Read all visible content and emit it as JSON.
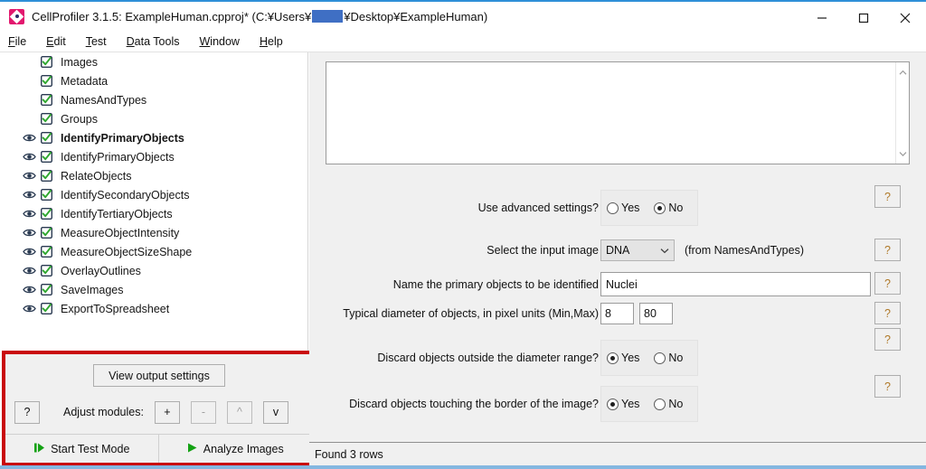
{
  "window": {
    "title_prefix": "CellProfiler 3.1.5: ExampleHuman.cpproj* (C:¥Users¥",
    "title_suffix": "¥Desktop¥ExampleHuman)",
    "app_icon": "cellprofiler-logo-icon",
    "controls": {
      "minimize": "minimize-icon",
      "maximize": "maximize-icon",
      "close": "close-icon"
    },
    "accent_color": "#2f8fd8"
  },
  "menubar": {
    "items": [
      {
        "accel": "F",
        "rest": "ile"
      },
      {
        "accel": "E",
        "rest": "dit"
      },
      {
        "accel": "T",
        "rest": "est"
      },
      {
        "accel": "D",
        "rest": "ata Tools"
      },
      {
        "accel": "W",
        "rest": "indow"
      },
      {
        "accel": "H",
        "rest": "elp"
      }
    ]
  },
  "pipeline": {
    "modules": [
      {
        "label": "Images",
        "eye": false,
        "checked": true,
        "selected": false
      },
      {
        "label": "Metadata",
        "eye": false,
        "checked": true,
        "selected": false
      },
      {
        "label": "NamesAndTypes",
        "eye": false,
        "checked": true,
        "selected": false
      },
      {
        "label": "Groups",
        "eye": false,
        "checked": true,
        "selected": false
      },
      {
        "label": "IdentifyPrimaryObjects",
        "eye": true,
        "checked": true,
        "selected": true
      },
      {
        "label": "IdentifyPrimaryObjects",
        "eye": true,
        "checked": true,
        "selected": false
      },
      {
        "label": "RelateObjects",
        "eye": true,
        "checked": true,
        "selected": false
      },
      {
        "label": "IdentifySecondaryObjects",
        "eye": true,
        "checked": true,
        "selected": false
      },
      {
        "label": "IdentifyTertiaryObjects",
        "eye": true,
        "checked": true,
        "selected": false
      },
      {
        "label": "MeasureObjectIntensity",
        "eye": true,
        "checked": true,
        "selected": false
      },
      {
        "label": "MeasureObjectSizeShape",
        "eye": true,
        "checked": true,
        "selected": false
      },
      {
        "label": "OverlayOutlines",
        "eye": true,
        "checked": true,
        "selected": false
      },
      {
        "label": "SaveImages",
        "eye": true,
        "checked": true,
        "selected": false
      },
      {
        "label": "ExportToSpreadsheet",
        "eye": true,
        "checked": true,
        "selected": false
      }
    ]
  },
  "controls_panel": {
    "highlight_color": "#c9070c",
    "view_output_label": "View output settings",
    "help_label": "?",
    "adjust_label": "Adjust modules:",
    "adjust_buttons": [
      {
        "label": "+",
        "enabled": true
      },
      {
        "label": "-",
        "enabled": false
      },
      {
        "label": "^",
        "enabled": false
      },
      {
        "label": "v",
        "enabled": true
      }
    ],
    "start_test_mode_label": "Start Test Mode",
    "analyze_images_label": "Analyze Images",
    "start_test_icon": "step-play-icon",
    "analyze_icon": "play-icon",
    "play_color": "#13a113"
  },
  "settings": {
    "notes": {
      "value": "",
      "scroll_up_icon": "chevron-up-icon",
      "scroll_down_icon": "chevron-down-icon"
    },
    "rows": [
      {
        "label": "Use advanced settings?",
        "type": "radio",
        "options": [
          "Yes",
          "No"
        ],
        "selected": "No",
        "help": "?"
      },
      {
        "label": "Select the input image",
        "type": "combo",
        "value": "DNA",
        "suffix": "(from NamesAndTypes)",
        "chevron": "chevron-down-icon",
        "help": "?"
      },
      {
        "label": "Name the primary objects to be identified",
        "type": "text",
        "value": "Nuclei",
        "help": "?"
      },
      {
        "label": "Typical diameter of objects, in pixel units (Min,Max)",
        "type": "range",
        "min_value": "8",
        "max_value": "80",
        "help": "?"
      },
      {
        "label": "Discard objects outside the diameter range?",
        "type": "radio",
        "options": [
          "Yes",
          "No"
        ],
        "selected": "Yes",
        "help": "?"
      },
      {
        "label": "Discard objects touching the border of the image?",
        "type": "radio",
        "options": [
          "Yes",
          "No"
        ],
        "selected": "Yes",
        "help": "?"
      }
    ]
  },
  "statusbar": {
    "text": "Found 3 rows"
  }
}
